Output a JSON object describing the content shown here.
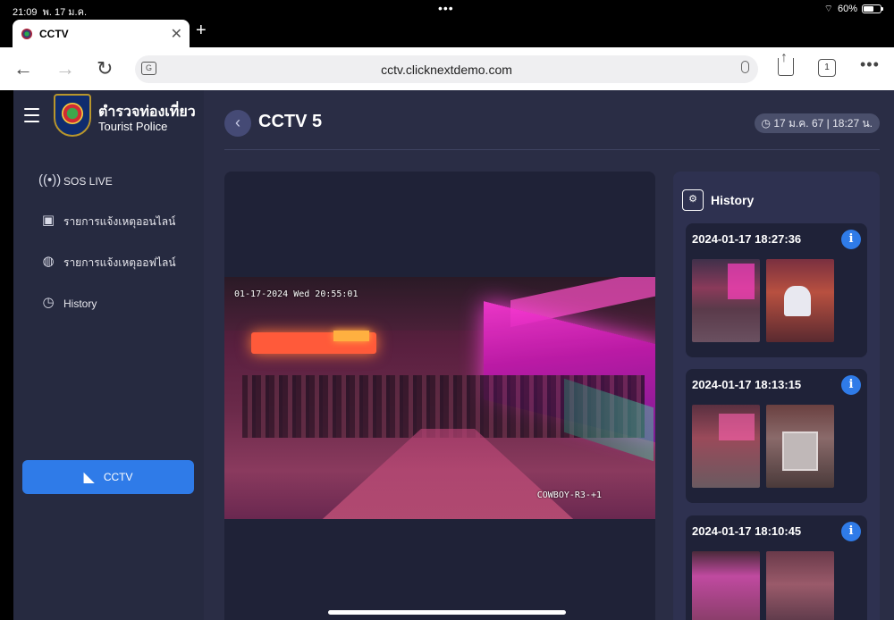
{
  "statusbar": {
    "time": "21:09",
    "date": "พ. 17 ม.ค.",
    "battery": "60%",
    "battery_level": 0.6
  },
  "browser": {
    "tab_title": "CCTV",
    "url": "cctv.clicknextdemo.com",
    "tab_count": "1"
  },
  "brand": {
    "name_th": "ตำรวจท่องเที่ยว",
    "name_en": "Tourist Police"
  },
  "sidebar": {
    "items": [
      {
        "label": "SOS LIVE",
        "icon": "broadcast-icon"
      },
      {
        "label": "รายการแจ้งเหตุออนไลน์",
        "icon": "online-report-icon"
      },
      {
        "label": "รายการแจ้งเหตุออฟไลน์",
        "icon": "globe-icon"
      },
      {
        "label": "History",
        "icon": "history-icon"
      }
    ],
    "cctv_button": "CCTV"
  },
  "header": {
    "title": "CCTV 5",
    "datetime": "17 ม.ค. 67 | 18:27 น."
  },
  "video": {
    "timestamp": "01-17-2024 Wed 20:55:01",
    "camera_label": "COWBOY-R3-+1"
  },
  "history": {
    "title": "History",
    "events": [
      {
        "time": "2024-01-17 18:27:36"
      },
      {
        "time": "2024-01-17 18:13:15"
      },
      {
        "time": "2024-01-17 18:10:45"
      }
    ]
  },
  "colors": {
    "accent": "#2f7be8",
    "sidebar_bg": "#262a40",
    "main_bg": "#2a2d45",
    "card_bg": "#2e3150"
  }
}
